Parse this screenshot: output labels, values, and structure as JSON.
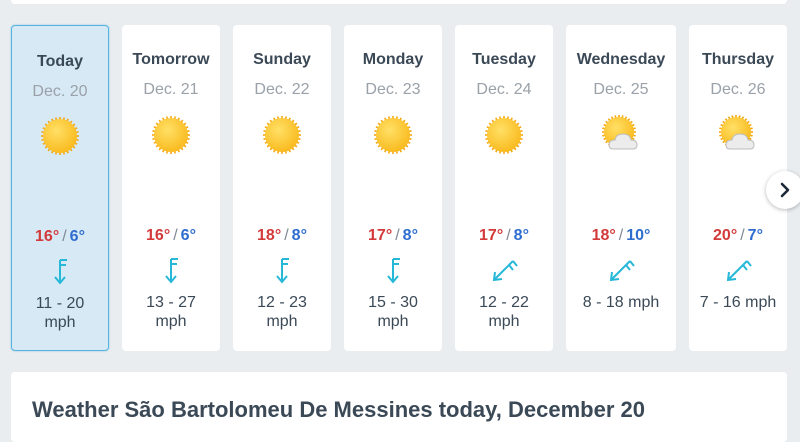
{
  "forecast": {
    "days": [
      {
        "name": "Today",
        "date": "Dec. 20",
        "condition_icon": "sun-icon",
        "temp_high": "16°",
        "temp_low": "6°",
        "wind_dir_icon": "wind-south-icon",
        "wind": "11 - 20\nmph",
        "selected": true
      },
      {
        "name": "Tomorrow",
        "date": "Dec. 21",
        "condition_icon": "sun-icon",
        "temp_high": "16°",
        "temp_low": "6°",
        "wind_dir_icon": "wind-south-icon",
        "wind": "13 - 27\nmph"
      },
      {
        "name": "Sunday",
        "date": "Dec. 22",
        "condition_icon": "sun-icon",
        "temp_high": "18°",
        "temp_low": "8°",
        "wind_dir_icon": "wind-south-icon",
        "wind": "12 - 23\nmph"
      },
      {
        "name": "Monday",
        "date": "Dec. 23",
        "condition_icon": "sun-icon",
        "temp_high": "17°",
        "temp_low": "8°",
        "wind_dir_icon": "wind-south-icon",
        "wind": "15 - 30\nmph"
      },
      {
        "name": "Tuesday",
        "date": "Dec. 24",
        "condition_icon": "sun-icon",
        "temp_high": "17°",
        "temp_low": "8°",
        "wind_dir_icon": "wind-southwest-icon",
        "wind": "12 - 22\nmph"
      },
      {
        "name": "Wednesday",
        "date": "Dec. 25",
        "condition_icon": "partly-cloudy-icon",
        "temp_high": "18°",
        "temp_low": "10°",
        "wind_dir_icon": "wind-southwest-icon",
        "wind": "8 - 18 mph"
      },
      {
        "name": "Thursday",
        "date": "Dec. 26",
        "condition_icon": "partly-cloudy-icon",
        "temp_high": "20°",
        "temp_low": "7°",
        "wind_dir_icon": "wind-southwest-icon",
        "wind": "7 - 16 mph"
      }
    ],
    "temp_separator": "/",
    "next_icon": "chevron-right-icon"
  },
  "today_section": {
    "title": "Weather São Bartolomeu De Messines today, December 20"
  },
  "colors": {
    "temp_high": "#d33a3a",
    "temp_low": "#2e6dcf",
    "wind_arrow": "#27b8d8",
    "sun": "#f9b81b",
    "selected_bg": "#d6e9f4",
    "selected_border": "#56b3e0"
  }
}
